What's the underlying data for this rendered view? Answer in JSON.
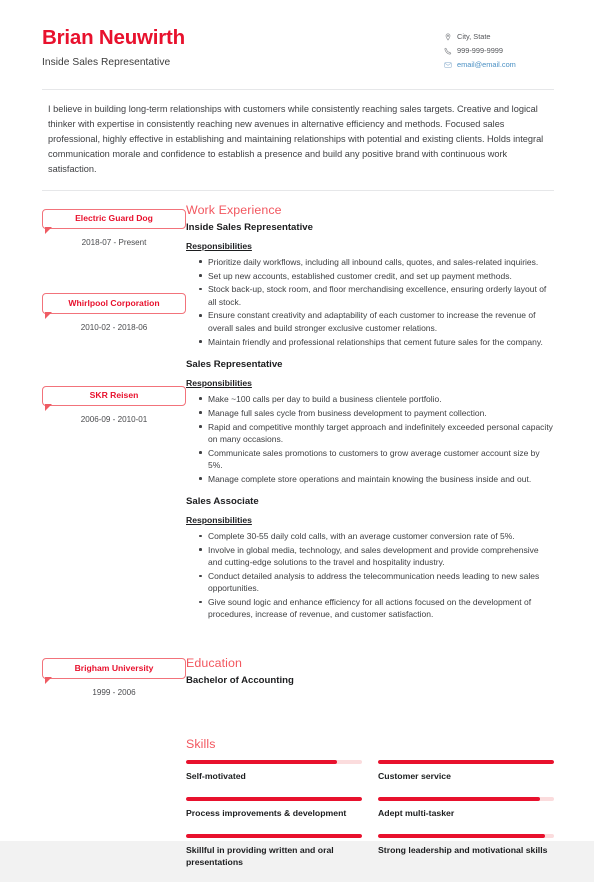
{
  "header": {
    "name": "Brian Neuwirth",
    "job_title": "Inside Sales Representative",
    "contact": {
      "location": "City, State",
      "location_icon": "map-pin-icon",
      "phone": "999-999-9999",
      "phone_icon": "phone-icon",
      "email": "email@email.com",
      "email_icon": "envelope-icon"
    }
  },
  "summary": "I believe in building long-term relationships with customers while consistently reaching sales targets. Creative and logical thinker with expertise in consistently reaching new avenues in alternative efficiency and methods. Focused sales professional, highly effective in establishing and maintaining relationships with potential and existing clients. Holds integral communication morale and confidence to establish a presence and build any positive brand with continuous work satisfaction.",
  "sections": {
    "work_experience_heading": "Work Experience",
    "education_heading": "Education",
    "skills_heading": "Skills",
    "responsibilities_label": "Responsibilities"
  },
  "experience": [
    {
      "company": "Electric Guard Dog",
      "dates": "2018-07 - Present",
      "title": "Inside Sales Representative",
      "bullets": [
        "Prioritize daily workflows, including all inbound calls, quotes, and sales-related inquiries.",
        "Set up new accounts, established customer credit, and set up payment methods.",
        "Stock back-up, stock room, and floor merchandising excellence, ensuring orderly layout of all stock.",
        "Ensure constant creativity and adaptability of each customer to increase the revenue of overall sales and build stronger exclusive customer relations.",
        "Maintain friendly and professional relationships that cement future sales for the company."
      ]
    },
    {
      "company": "Whirlpool Corporation",
      "dates": "2010-02 - 2018-06",
      "title": "Sales Representative",
      "bullets": [
        "Make ~100 calls per day to build a business clientele portfolio.",
        "Manage full sales cycle from business development to payment collection.",
        "Rapid and competitive monthly target approach and indefinitely exceeded personal capacity on many occasions.",
        "Communicate sales promotions to customers to grow average customer account size by 5%.",
        "Manage complete store operations and maintain knowing the business inside and out."
      ]
    },
    {
      "company": "SKR Reisen",
      "dates": "2006-09 - 2010-01",
      "title": "Sales Associate",
      "bullets": [
        "Complete 30-55 daily cold calls, with an average customer conversion rate of 5%.",
        "Involve in global media, technology, and sales development and provide comprehensive and cutting-edge solutions to the travel and hospitality industry.",
        "Conduct detailed analysis to address the telecommunication needs leading to new sales opportunities.",
        "Give sound logic and enhance efficiency for all actions focused on the development of procedures, increase of revenue, and customer satisfaction."
      ]
    }
  ],
  "education": [
    {
      "school": "Brigham University",
      "dates": "1999 - 2006",
      "degree": "Bachelor of Accounting"
    }
  ],
  "skills": [
    {
      "name": "Self-motivated",
      "level": 86
    },
    {
      "name": "Customer service",
      "level": 100
    },
    {
      "name": "Process improvements & development",
      "level": 100
    },
    {
      "name": "Adept multi-tasker",
      "level": 92
    },
    {
      "name": "Skillful in providing written and oral presentations",
      "level": 100
    },
    {
      "name": "Strong leadership and motivational skills",
      "level": 95
    }
  ],
  "colors": {
    "accent_red": "#e8112d",
    "heading_red": "#f2575f",
    "badge_border": "#f2737b",
    "bar_track": "#fbdcdd",
    "email_blue": "#4a90c4",
    "divider": "#e6e7e9"
  }
}
